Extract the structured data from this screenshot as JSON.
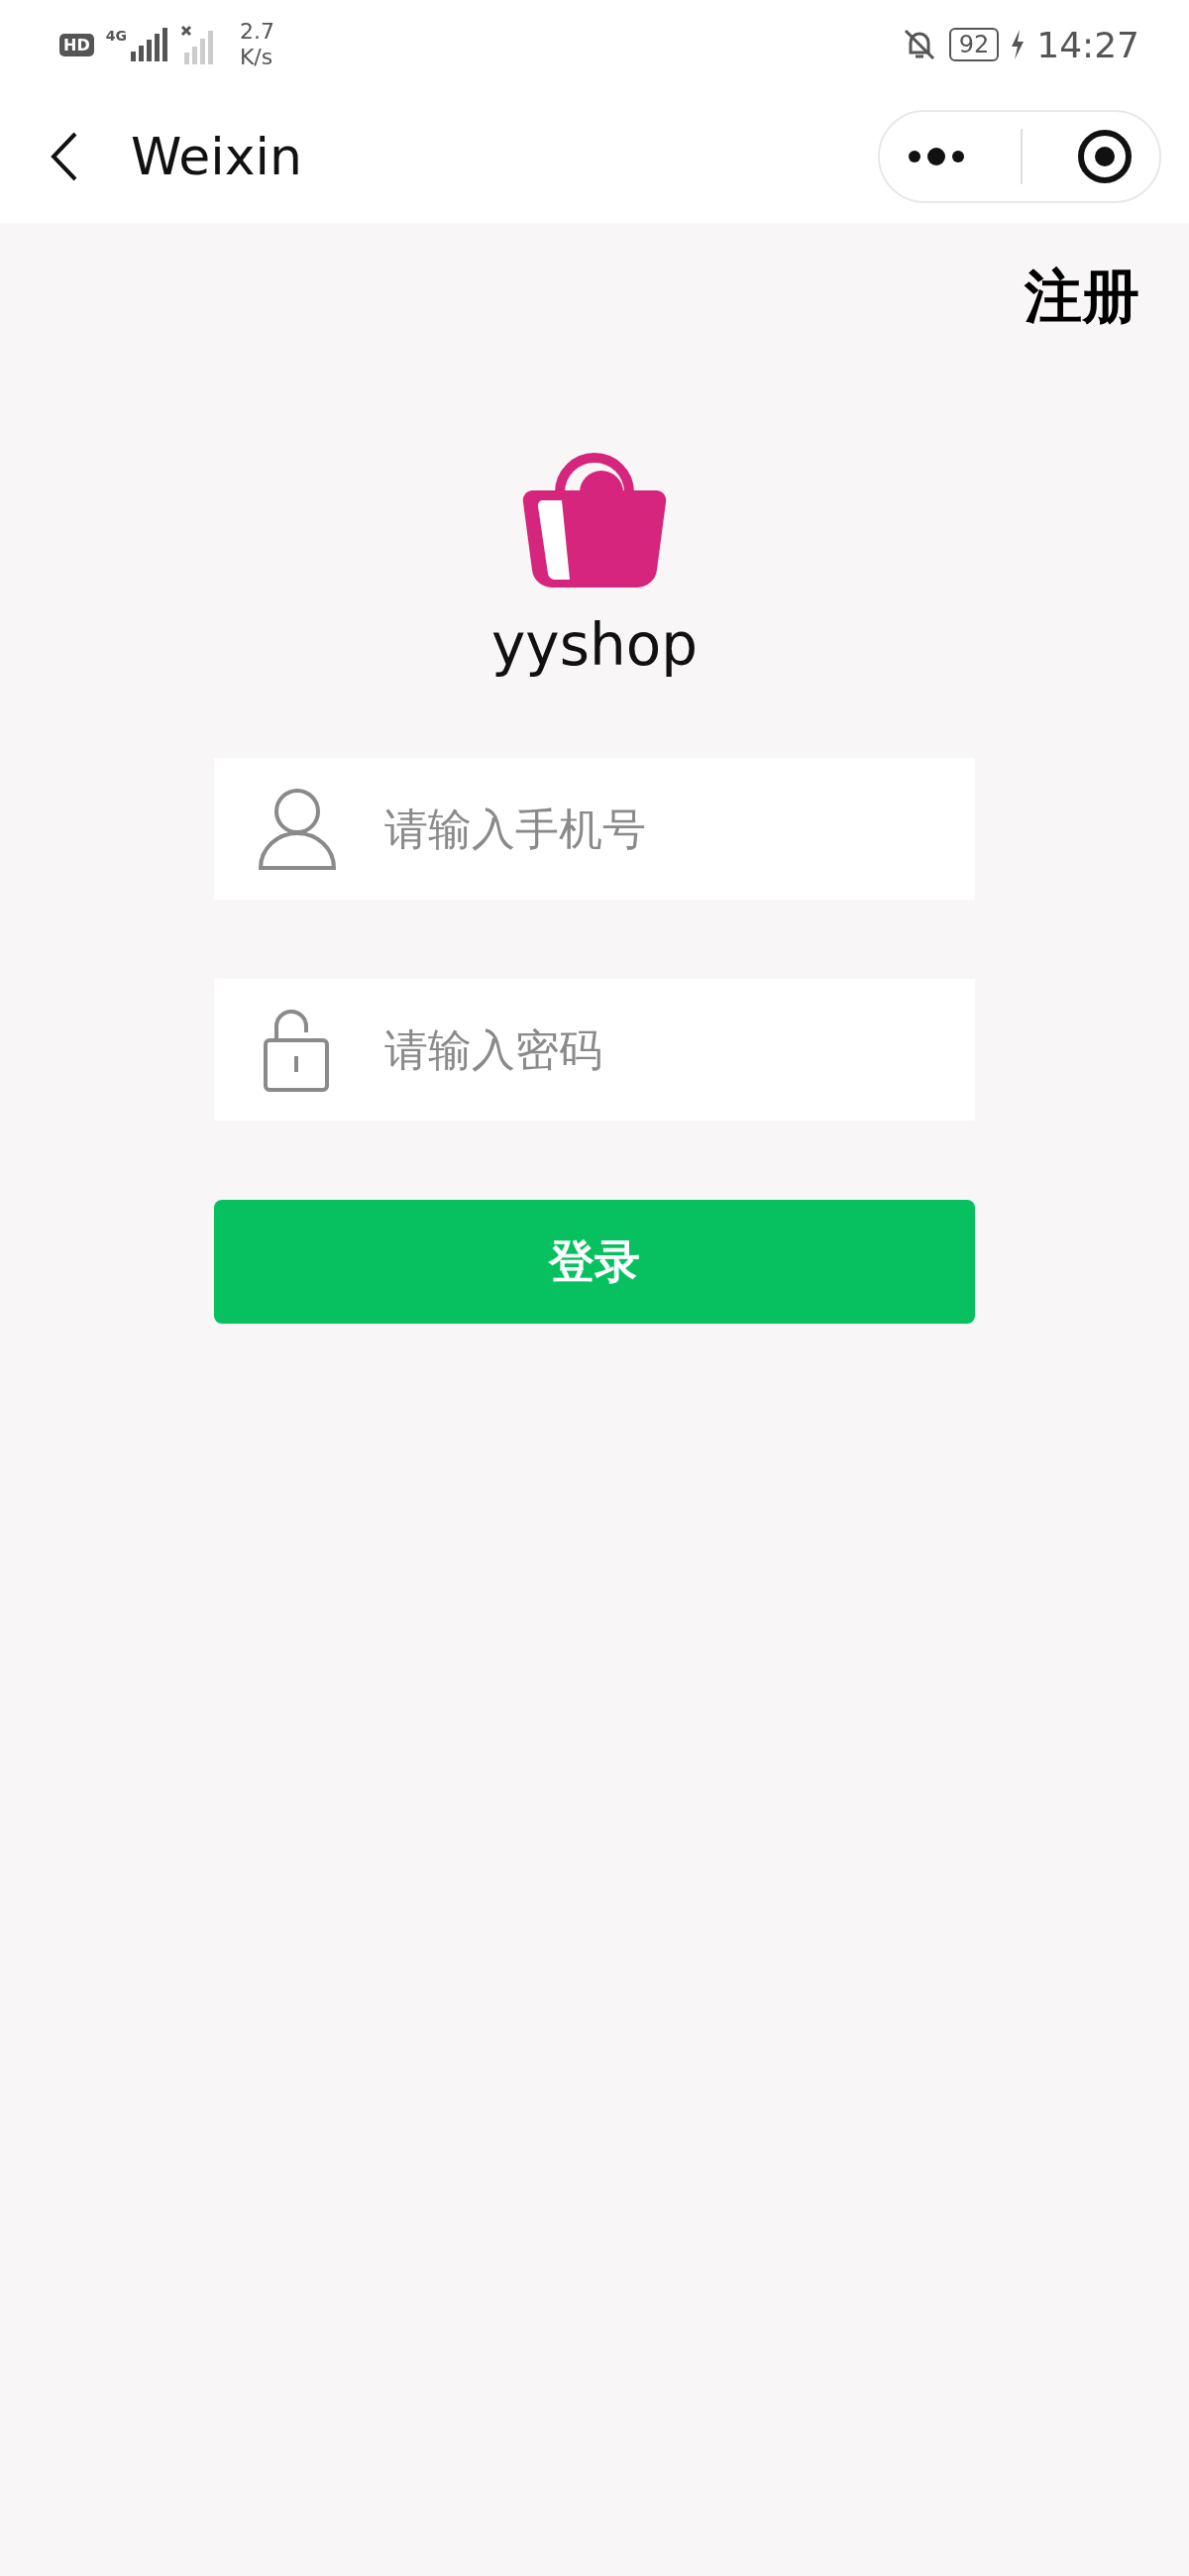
{
  "status_bar": {
    "hd_label": "HD",
    "network_type": "4G",
    "speed_value": "2.7",
    "speed_unit": "K/s",
    "battery": "92",
    "time": "14:27"
  },
  "nav": {
    "title": "Weixin"
  },
  "register_link": "注册",
  "app_name": "yyshop",
  "fields": [
    {
      "kind": "phone",
      "placeholder": "请输入手机号"
    },
    {
      "kind": "password",
      "placeholder": "请输入密码"
    }
  ],
  "login_button": "登录"
}
